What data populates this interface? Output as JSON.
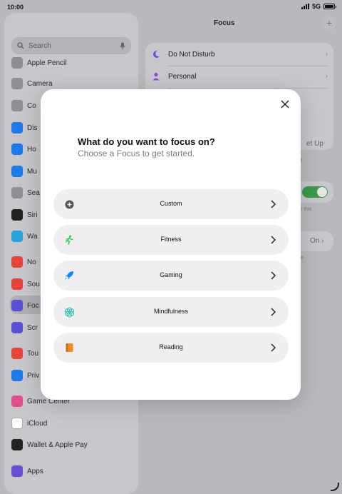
{
  "status": {
    "time": "10:00",
    "network": "5G"
  },
  "sidebar": {
    "search_placeholder": "Search",
    "items": [
      {
        "label": "Apple Pencil",
        "icon": "pencil-icon",
        "color": "#8e8e93"
      },
      {
        "label": "Camera",
        "icon": "camera-icon",
        "color": "#8e8e93"
      },
      {
        "label": "Co",
        "icon": "control-centre-icon",
        "color": "#8e8e93"
      },
      {
        "label": "Dis",
        "icon": "display-icon",
        "color": "#1e7ae8"
      },
      {
        "label": "Ho",
        "icon": "home-screen-icon",
        "color": "#1e7ae8"
      },
      {
        "label": "Mu",
        "icon": "multitasking-icon",
        "color": "#1e7ae8"
      },
      {
        "label": "Sea",
        "icon": "search-icon",
        "color": "#8e8e93"
      },
      {
        "label": "Siri",
        "icon": "siri-icon",
        "color": "#222222"
      },
      {
        "label": "Wa",
        "icon": "wallpaper-icon",
        "color": "#2aa3d8"
      },
      {
        "label": "No",
        "icon": "notifications-icon",
        "color": "#e5443a"
      },
      {
        "label": "Sou",
        "icon": "sounds-icon",
        "color": "#e5443a"
      },
      {
        "label": "Foc",
        "icon": "focus-moon-icon",
        "color": "#5b4fd6"
      },
      {
        "label": "Scr",
        "icon": "screen-time-icon",
        "color": "#5b4fd6"
      },
      {
        "label": "Tou",
        "icon": "touch-id-icon",
        "color": "#e5443a"
      },
      {
        "label": "Priv",
        "icon": "privacy-hand-icon",
        "color": "#1e7ae8"
      },
      {
        "label": "Game Center",
        "icon": "game-center-icon",
        "color": "#e04f8c"
      },
      {
        "label": "iCloud",
        "icon": "icloud-icon",
        "color": "#ffffff"
      },
      {
        "label": "Wallet & Apple Pay",
        "icon": "wallet-icon",
        "color": "#222222"
      },
      {
        "label": "Apps",
        "icon": "apps-icon",
        "color": "#6a4fd6"
      }
    ]
  },
  "main": {
    "title": "Focus",
    "rows": [
      {
        "label": "Do Not Disturb",
        "icon": "moon-icon"
      },
      {
        "label": "Personal",
        "icon": "person-icon"
      }
    ],
    "setup_label": "et Up",
    "on_label": "On",
    "note_d": "d",
    "note_this": "r this",
    "note_e": "e"
  },
  "modal": {
    "title": "What do you want to focus on?",
    "subtitle": "Choose a Focus to get started.",
    "options": [
      {
        "label": "Custom",
        "icon": "plus-circle-icon",
        "color": "#555555"
      },
      {
        "label": "Fitness",
        "icon": "running-figure-icon",
        "color": "#34c759"
      },
      {
        "label": "Gaming",
        "icon": "rocket-icon",
        "color": "#0a84ff"
      },
      {
        "label": "Mindfulness",
        "icon": "flower-icon",
        "color": "#30c0b0"
      },
      {
        "label": "Reading",
        "icon": "book-icon",
        "color": "#f08a24"
      }
    ]
  }
}
